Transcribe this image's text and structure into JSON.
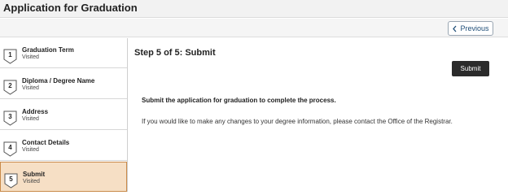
{
  "header": {
    "title": "Application for Graduation"
  },
  "toolbar": {
    "previous_label": "Previous"
  },
  "sidebar": {
    "steps": [
      {
        "number": "1",
        "label": "Graduation Term",
        "status": "Visited",
        "active": false
      },
      {
        "number": "2",
        "label": "Diploma / Degree Name",
        "status": "Visited",
        "active": false
      },
      {
        "number": "3",
        "label": "Address",
        "status": "Visited",
        "active": false
      },
      {
        "number": "4",
        "label": "Contact Details",
        "status": "Visited",
        "active": false
      },
      {
        "number": "5",
        "label": "Submit",
        "status": "Visited",
        "active": true
      }
    ]
  },
  "main": {
    "step_title": "Step 5 of 5: Submit",
    "submit_label": "Submit",
    "instruction": "Submit the application for graduation to complete the process.",
    "note": "If you would like to make any changes to your degree information, please contact the Office of the Registrar."
  },
  "colors": {
    "active_step_bg": "#f6dfc5",
    "active_step_border": "#c98a4a",
    "submit_bg": "#2b2b2b",
    "previous_border": "#9aa6b2"
  }
}
